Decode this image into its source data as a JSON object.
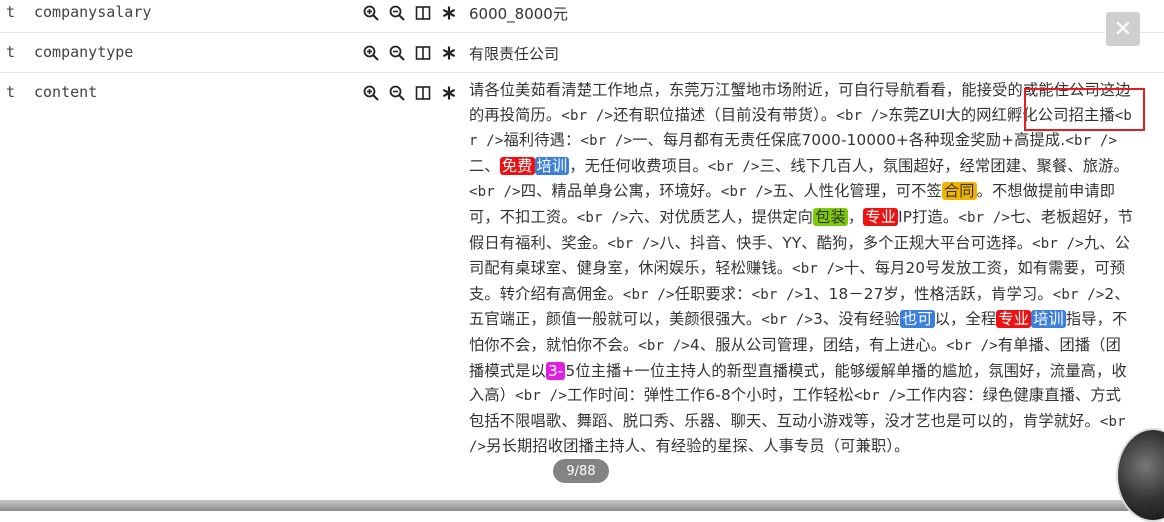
{
  "rows": [
    {
      "type": "t",
      "field": "companysalary",
      "value": "6000_8000元"
    },
    {
      "type": "t",
      "field": "companytype",
      "value": "有限责任公司"
    },
    {
      "type": "t",
      "field": "content"
    }
  ],
  "icons": [
    "zoom-in-icon",
    "zoom-out-icon",
    "columns-icon",
    "asterisk-icon"
  ],
  "content_segments": [
    {
      "t": "请各位美茹看清楚工作地点，东莞万江蟹地市场附近，可自行导航看看，能接受的或能住公司这边的再投简历。"
    },
    {
      "t": "<br />",
      "code": true
    },
    {
      "t": "还有职位描述（目前没有带货）。"
    },
    {
      "t": "<br />",
      "code": true
    },
    {
      "t": "东莞ZUI大的网红孵化公司招主播"
    },
    {
      "t": "<br />",
      "code": true
    },
    {
      "t": "福利待遇："
    },
    {
      "t": "<br />",
      "code": true
    },
    {
      "t": "一、每月都有无责任保底7000-10000+各种现金奖励+高提成."
    },
    {
      "t": "<br />",
      "code": true
    },
    {
      "t": "二、"
    },
    {
      "t": "免费",
      "hl": "red"
    },
    {
      "t": "培训",
      "hl": "blue"
    },
    {
      "t": "，无任何收费项目。"
    },
    {
      "t": "<br />",
      "code": true
    },
    {
      "t": "三、线下几百人，氛围超好，经常团建、聚餐、旅游。"
    },
    {
      "t": "<br />",
      "code": true
    },
    {
      "t": "四、精品单身公寓，环境好。"
    },
    {
      "t": "<br />",
      "code": true
    },
    {
      "t": "五、人性化管理，可不签"
    },
    {
      "t": "合同",
      "hl": "orange"
    },
    {
      "t": "。不想做提前申请即可，不扣工资。"
    },
    {
      "t": "<br />",
      "code": true
    },
    {
      "t": "六、对优质艺人，提供定向"
    },
    {
      "t": "包装",
      "hl": "green"
    },
    {
      "t": "，"
    },
    {
      "t": "专业",
      "hl": "red"
    },
    {
      "t": "IP打造。"
    },
    {
      "t": "<br />",
      "code": true
    },
    {
      "t": "七、老板超好，节假日有福利、奖金。"
    },
    {
      "t": "<br />",
      "code": true
    },
    {
      "t": "八、抖音、快手、YY、酷狗，多个正规大平台可选择。"
    },
    {
      "t": "<br />",
      "code": true
    },
    {
      "t": "九、公司配有桌球室、健身室，休闲娱乐，轻松赚钱。"
    },
    {
      "t": "<br />",
      "code": true
    },
    {
      "t": "十、每月20号发放工资，如有需要，可预支。转介绍有高佣金。"
    },
    {
      "t": "<br />",
      "code": true
    },
    {
      "t": "任职要求："
    },
    {
      "t": "<br />",
      "code": true
    },
    {
      "t": "1、18－27岁，性格活跃，肯学习。"
    },
    {
      "t": "<br />",
      "code": true
    },
    {
      "t": "2、五官端正，颜值一般就可以，美颜很强大。"
    },
    {
      "t": "<br />",
      "code": true
    },
    {
      "t": "3、没有经验"
    },
    {
      "t": "也可",
      "hl": "blue"
    },
    {
      "t": "以，全程"
    },
    {
      "t": "专业",
      "hl": "red"
    },
    {
      "t": "培训",
      "hl": "blue"
    },
    {
      "t": "指导，不怕你不会，就怕你不会。"
    },
    {
      "t": "<br />",
      "code": true
    },
    {
      "t": "4、服从公司管理，团结，有上进心。"
    },
    {
      "t": "<br />",
      "code": true
    },
    {
      "t": "有单播、团播（团播模式是以"
    },
    {
      "t": "3-",
      "hl": "magenta"
    },
    {
      "t": "5位主播+一位主持人的新型直播模式，能够缓解单播的尴尬，氛围好，流量高，收入高）"
    },
    {
      "t": "<br />",
      "code": true
    },
    {
      "t": "工作时间：弹性工作6-8个小时，工作轻松"
    },
    {
      "t": "<br />",
      "code": true
    },
    {
      "t": "工作内容：绿色健康直播、方式包括不限唱歌、舞蹈、脱口秀、乐器、聊天、互动小游戏等，没才艺也是可以的，肯学就好。"
    },
    {
      "t": "<br />",
      "code": true
    },
    {
      "t": "另长期招收团播主持人、有经验的星探、人事专员（可兼职）。"
    }
  ],
  "close_label": "✕",
  "pager": "9/88"
}
